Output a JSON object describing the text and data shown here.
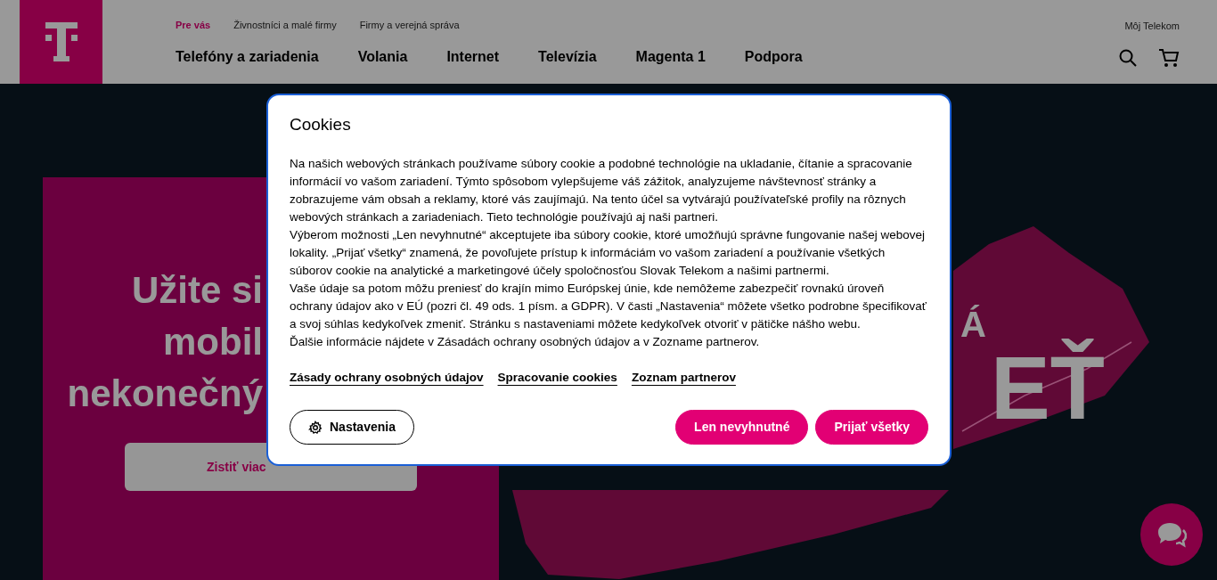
{
  "header": {
    "top_links": [
      {
        "label": "Pre vás",
        "selected": true
      },
      {
        "label": "Živnostníci a malé firmy",
        "selected": false
      },
      {
        "label": "Firmy a verejná správa",
        "selected": false
      }
    ],
    "account_link": "Môj Telekom",
    "main_nav": [
      "Telefóny a zariadenia",
      "Volania",
      "Internet",
      "Televízia",
      "Magenta 1",
      "Podpora"
    ]
  },
  "hero": {
    "heading_lines": [
      "Užite si",
      "mobil",
      "nekonečný"
    ],
    "button": "Zistiť viac",
    "map_text_lines": [
      "Á",
      "EŤ"
    ]
  },
  "cookie_dialog": {
    "title": "Cookies",
    "paragraphs": [
      "Na našich webových stránkach používame súbory cookie a podobné technológie na ukladanie, čítanie a spracovanie informácií vo vašom zariadení. Týmto spôsobom vylepšujeme váš zážitok, analyzujeme návštevnosť stránky a zobrazujeme vám obsah a reklamy, ktoré vás zaujímajú. Na tento účel sa vytvárajú používateľské profily na rôznych webových stránkach a zariadeniach. Tieto technológie používajú aj naši partneri.",
      "Výberom možnosti „Len nevyhnutné“ akceptujete iba súbory cookie, ktoré umožňujú správne fungovanie našej webovej lokality. „Prijať všetky“ znamená, že povoľujete prístup k informáciám vo vašom zariadení a používanie všetkých súborov cookie na analytické a marketingové účely spoločnosťou Slovak Telekom a našimi partnermi.",
      "Vaše údaje sa potom môžu preniesť do krajín mimo Európskej únie, kde nemôžeme zabezpečiť rovnakú úroveň ochrany údajov ako v EÚ (pozri čl. 49 ods. 1 písm. a GDPR). V časti „Nastavenia“ môžete všetko podrobne špecifikovať a svoj súhlas kedykoľvek zmeniť. Stránku s nastaveniami môžete kedykoľvek otvoriť v pätičke nášho webu.",
      "Ďalšie informácie nájdete v Zásadách ochrany osobných údajov a v Zozname partnerov."
    ],
    "links": [
      "Zásady ochrany osobných údajov",
      "Spracovanie cookies",
      "Zoznam partnerov"
    ],
    "buttons": [
      {
        "label": "Nastavenia",
        "kind": "outline"
      },
      {
        "label": "Len nevyhnutné",
        "kind": "primary"
      },
      {
        "label": "Prijať všetky",
        "kind": "primary"
      }
    ]
  }
}
